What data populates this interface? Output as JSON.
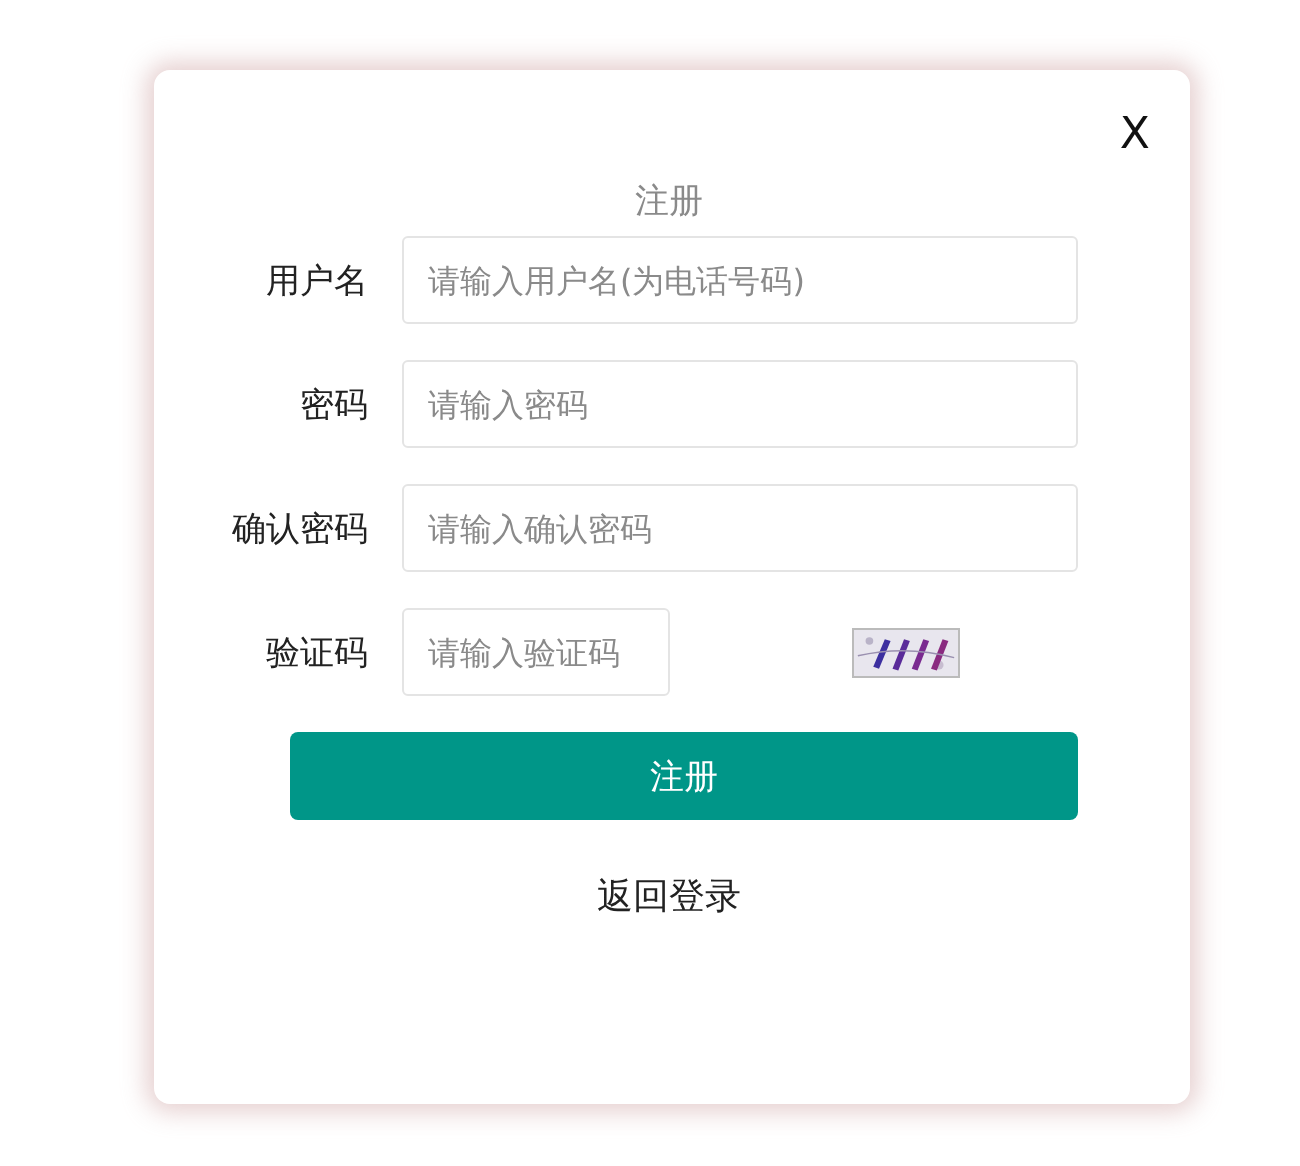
{
  "dialog": {
    "close": "X",
    "title": "注册"
  },
  "fields": [
    {
      "kind": "text",
      "label": "用户名",
      "placeholder": "请输入用户名(为电话号码)"
    },
    {
      "kind": "password",
      "label": "密码",
      "placeholder": "请输入密码"
    },
    {
      "kind": "password",
      "label": "确认密码",
      "placeholder": "请输入确认密码"
    },
    {
      "kind": "captcha",
      "label": "验证码",
      "placeholder": "请输入验证码"
    }
  ],
  "submit": "注册",
  "back_link": "返回登录"
}
